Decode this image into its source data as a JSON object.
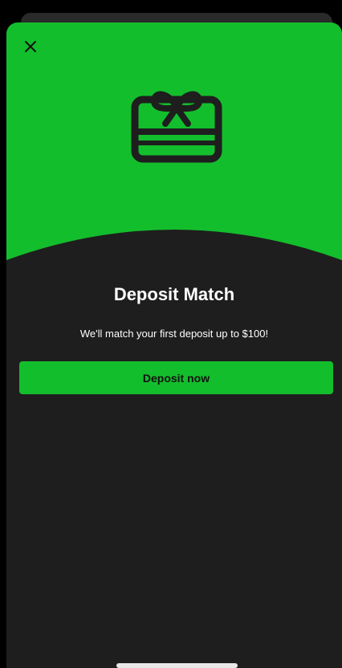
{
  "modal": {
    "title": "Deposit Match",
    "subtitle": "We'll match your first deposit up to $100!",
    "cta_label": "Deposit now",
    "close_icon": "close-icon",
    "hero_icon": "gift-card-icon"
  },
  "colors": {
    "accent": "#13be2c",
    "sheet_background": "#1e1e1e",
    "text": "#ffffff"
  }
}
